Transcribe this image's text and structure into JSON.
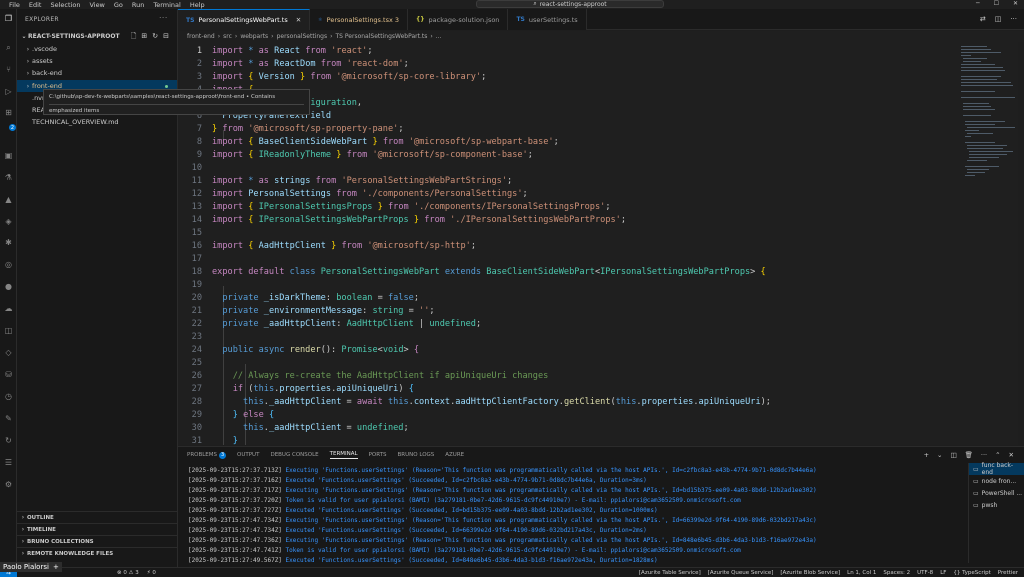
{
  "titlebar": {
    "menu": [
      "File",
      "Edit",
      "Selection",
      "View",
      "Go",
      "Run",
      "Terminal",
      "Help"
    ],
    "search": "react-settings-approot"
  },
  "explorer": {
    "title": "EXPLORER",
    "root": "REACT-SETTINGS-APPROOT",
    "items": [
      {
        "label": ".vscode",
        "type": "folder"
      },
      {
        "label": "assets",
        "type": "folder"
      },
      {
        "label": "back-end",
        "type": "folder"
      },
      {
        "label": "front-end",
        "type": "folder",
        "modified": true
      },
      {
        "label": ".nvmrc",
        "type": "file"
      },
      {
        "label": "READM",
        "type": "file"
      },
      {
        "label": "TECHNICAL_OVERVIEW.md",
        "type": "file"
      }
    ],
    "tooltip": {
      "path": "C:\\github\\sp-dev-fx-webparts\\samples\\react-settings-approot\\front-end • Contains",
      "extra": "emphasized items"
    },
    "sections": [
      "OUTLINE",
      "TIMELINE",
      "BRUNO COLLECTIONS",
      "REMOTE KNOWLEDGE FILES"
    ]
  },
  "tabs": [
    {
      "label": "PersonalSettingsWebPart.ts",
      "icon": "TS",
      "active": true
    },
    {
      "label": "PersonalSettings.tsx 3",
      "icon": "TSX",
      "modified": true
    },
    {
      "label": "package-solution.json",
      "icon": "{}"
    },
    {
      "label": "userSettings.ts",
      "icon": "TS"
    }
  ],
  "breadcrumb": [
    "front-end",
    "src",
    "webparts",
    "personalSettings",
    "TS PersonalSettingsWebPart.ts",
    "..."
  ],
  "editor": {
    "line_numbers": [
      "1",
      "2",
      "3",
      "4",
      "5",
      "6",
      "7",
      "8",
      "9",
      "10",
      "11",
      "12",
      "13",
      "14",
      "15",
      "16",
      "17",
      "18",
      "19",
      "20",
      "21",
      "22",
      "23",
      "24",
      "25",
      "26",
      "27",
      "28",
      "29",
      "30",
      "31"
    ]
  },
  "panel": {
    "tabs": [
      {
        "label": "PROBLEMS",
        "badge": "3"
      },
      {
        "label": "OUTPUT"
      },
      {
        "label": "DEBUG CONSOLE"
      },
      {
        "label": "TERMINAL",
        "active": true
      },
      {
        "label": "PORTS"
      },
      {
        "label": "BRUNO LOGS"
      },
      {
        "label": "AZURE"
      }
    ],
    "logs": [
      {
        "ts": "[2025-09-23T15:27:37.713Z]",
        "msg": "Executing 'Functions.userSettings' (Reason='This function was programmatically called via the host APIs.', Id=c2fbc8a3-e43b-4774-9b71-0d8dc7b44e6a)"
      },
      {
        "ts": "[2025-09-23T15:27:37.716Z]",
        "msg": "Executed 'Functions.userSettings' (Succeeded, Id=c2fbc8a3-e43b-4774-9b71-0d8dc7b44e6a, Duration=3ms)"
      },
      {
        "ts": "[2025-09-23T15:27:37.717Z]",
        "msg": "Executing 'Functions.userSettings' (Reason='This function was programmatically called via the host APIs.', Id=bd15b375-ee09-4a03-8bdd-12b2ad1ee302)"
      },
      {
        "ts": "[2025-09-23T15:27:37.720Z]",
        "msg": "Token is valid for user ppialorsi (BAMI) (3a279181-0be7-42d6-9615-dc9fc44910e7) - E-mail: ppialorsi@cam3652509.onmicrosoft.com"
      },
      {
        "ts": "[2025-09-23T15:27:37.727Z]",
        "msg": "Executed 'Functions.userSettings' (Succeeded, Id=bd15b375-ee09-4a03-8bdd-12b2ad1ee302, Duration=1000ms)"
      },
      {
        "ts": "[2025-09-23T15:27:47.734Z]",
        "msg": "Executing 'Functions.userSettings' (Reason='This function was programmatically called via the host APIs.', Id=66399e2d-9f64-4190-89d6-032bd217a43c)"
      },
      {
        "ts": "[2025-09-23T15:27:47.734Z]",
        "msg": "Executed 'Functions.userSettings' (Succeeded, Id=66399e2d-9f64-4190-89d6-032bd217a43c, Duration=2ms)"
      },
      {
        "ts": "[2025-09-23T15:27:47.736Z]",
        "msg": "Executing 'Functions.userSettings' (Reason='This function was programmatically called via the host APIs.', Id=848e6b45-d3b6-4da3-b1d3-f16ae972e43a)"
      },
      {
        "ts": "[2025-09-23T15:27:47.741Z]",
        "msg": "Token is valid for user ppialorsi (BAMI) (3a279181-0be7-42d6-9615-dc9fc44910e7) - E-mail: ppialorsi@cam3652509.onmicrosoft.com"
      },
      {
        "ts": "[2025-09-23T15:27:49.567Z]",
        "msg": "Executed 'Functions.userSettings' (Succeeded, Id=848e6b45-d3b6-4da3-b1d3-f16ae972e43a, Duration=1828ms)"
      }
    ],
    "terminals": [
      {
        "label": "func back-end",
        "active": true
      },
      {
        "label": "node fron..."
      },
      {
        "label": "PowerShell ..."
      },
      {
        "label": "pwsh"
      }
    ]
  },
  "statusbar": {
    "left": [
      "⊗ 0 ⚠ 3",
      "⚡ 0"
    ],
    "right": [
      "[Azurite Table Service]",
      "[Azurite Queue Service]",
      "[Azurite Blob Service]",
      "Ln 1, Col 1",
      "Spaces: 2",
      "UTF-8",
      "LF",
      "{} TypeScript",
      "Prettier"
    ]
  },
  "user": {
    "name": "Paolo Pialorsi"
  },
  "colors": {
    "accent": "#0078d4",
    "keyword": "#569cd6",
    "control": "#c586c0",
    "string": "#ce9178",
    "type": "#4ec9b0",
    "function": "#dcdcaa",
    "variable": "#9cdcfe",
    "comment": "#6a9955"
  }
}
